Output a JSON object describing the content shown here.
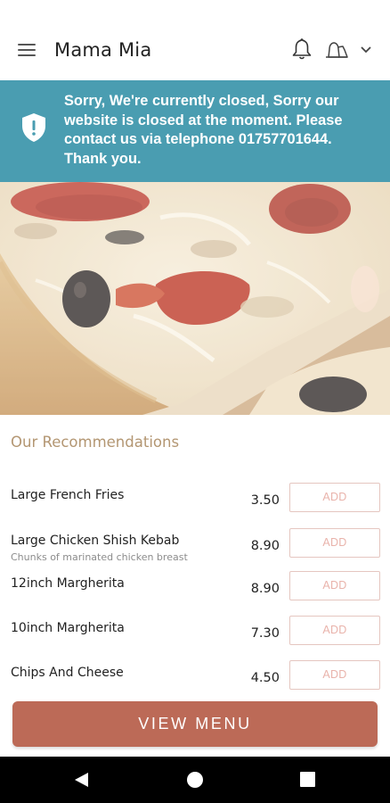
{
  "header": {
    "title": "Mama Mia",
    "menu_icon": "hamburger-menu-icon",
    "notification_icon": "bell-icon",
    "account_icon": "user-icon",
    "dropdown_icon": "chevron-down-icon"
  },
  "banner": {
    "icon": "shield-alert-icon",
    "message": "Sorry, We're currently closed, Sorry our website is closed at the moment. Please contact us via telephone 01757701644. Thank you.",
    "background": "#4a9db1"
  },
  "hero": {
    "image": "pizza-photo"
  },
  "recommendations": {
    "title": "Our Recommendations",
    "items": [
      {
        "name": "Large French Fries",
        "description": "",
        "price": "3.50",
        "add_label": "ADD"
      },
      {
        "name": "Large Chicken Shish Kebab",
        "description": "Chunks of marinated chicken breast",
        "price": "8.90",
        "add_label": "ADD"
      },
      {
        "name": "12inch Margherita",
        "description": "",
        "price": "8.90",
        "add_label": "ADD"
      },
      {
        "name": "10inch Margherita",
        "description": "",
        "price": "7.30",
        "add_label": "ADD"
      },
      {
        "name": "Chips And Cheese",
        "description": "",
        "price": "4.50",
        "add_label": "ADD"
      }
    ]
  },
  "view_menu": {
    "label": "VIEW MENU",
    "color": "#bc6a57"
  },
  "system_nav": {
    "back_icon": "back-triangle-icon",
    "home_icon": "home-circle-icon",
    "recents_icon": "recents-square-icon"
  },
  "colors": {
    "accent_text": "#b39672",
    "add_button_text": "#e9b3ab"
  }
}
